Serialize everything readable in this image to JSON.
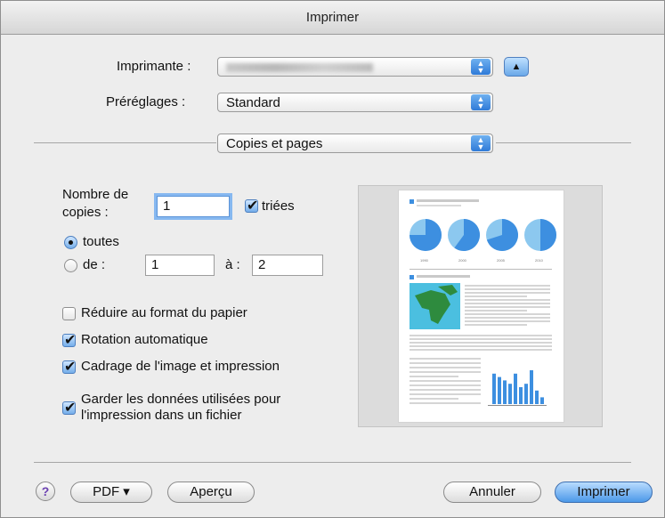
{
  "window": {
    "title": "Imprimer"
  },
  "printer": {
    "label": "Imprimante :",
    "value_redacted": true
  },
  "presets": {
    "label": "Préréglages :",
    "value": "Standard"
  },
  "section": {
    "value": "Copies et pages"
  },
  "copies": {
    "label_line1": "Nombre de",
    "label_line2": "copies :",
    "value": "1",
    "collated_label": "triées",
    "collated": true
  },
  "pages": {
    "all_label": "toutes",
    "from_label": "de :",
    "from_value": "1",
    "to_label": "à :",
    "to_value": "2"
  },
  "options": [
    {
      "label": "Réduire au format du papier",
      "checked": false
    },
    {
      "label": "Rotation automatique",
      "checked": true
    },
    {
      "label": "Cadrage de l'image et impression",
      "checked": true
    },
    {
      "label_line1": "Garder les données utilisées pour",
      "label_line2": "l'impression dans un fichier",
      "checked": true
    }
  ],
  "preview": {
    "chart_years": [
      "1990",
      "2000",
      "2005",
      "2010"
    ],
    "pie_fill": [
      0.75,
      0.6,
      0.7,
      0.5
    ],
    "bar_values": [
      9,
      8,
      7,
      6,
      9,
      5,
      6,
      10,
      4,
      2
    ]
  },
  "buttons": {
    "help": "?",
    "pdf": "PDF ▾",
    "preview": "Aperçu",
    "cancel": "Annuler",
    "print": "Imprimer"
  },
  "colors": {
    "accent": "#3d8fe0",
    "default_button": "#4c98e8"
  }
}
